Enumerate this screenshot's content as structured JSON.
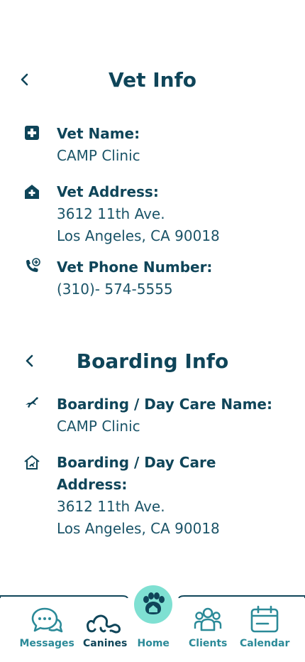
{
  "vet_section": {
    "title": "Vet Info",
    "items": [
      {
        "label": "Vet Name:",
        "lines": [
          "CAMP Clinic"
        ]
      },
      {
        "label": "Vet Address:",
        "lines": [
          "3612 11th Ave.",
          "Los Angeles, CA 90018"
        ]
      },
      {
        "label": "Vet Phone Number:",
        "lines": [
          "(310)- 574-5555"
        ]
      }
    ]
  },
  "boarding_section": {
    "title": "Boarding Info",
    "items": [
      {
        "label": "Boarding / Day Care Name:",
        "lines": [
          "CAMP Clinic"
        ]
      },
      {
        "label_lines": [
          "Boarding / Day Care",
          "Address:"
        ],
        "lines": [
          "3612 11th Ave.",
          "Los Angeles, CA 90018"
        ]
      }
    ]
  },
  "tabbar": {
    "tabs": [
      {
        "label": "Messages",
        "icon": "chat-icon",
        "active": false
      },
      {
        "label": "Canines",
        "icon": "dog-icon",
        "active": true
      },
      {
        "label": "Home",
        "icon": "paw-home-icon",
        "active": false
      },
      {
        "label": "Clients",
        "icon": "people-icon",
        "active": false
      },
      {
        "label": "Calendar",
        "icon": "calendar-icon",
        "active": false
      }
    ]
  },
  "colors": {
    "primary": "#0f4559",
    "accent": "#2b8a98",
    "home_bubble": "#7fe0d2"
  }
}
